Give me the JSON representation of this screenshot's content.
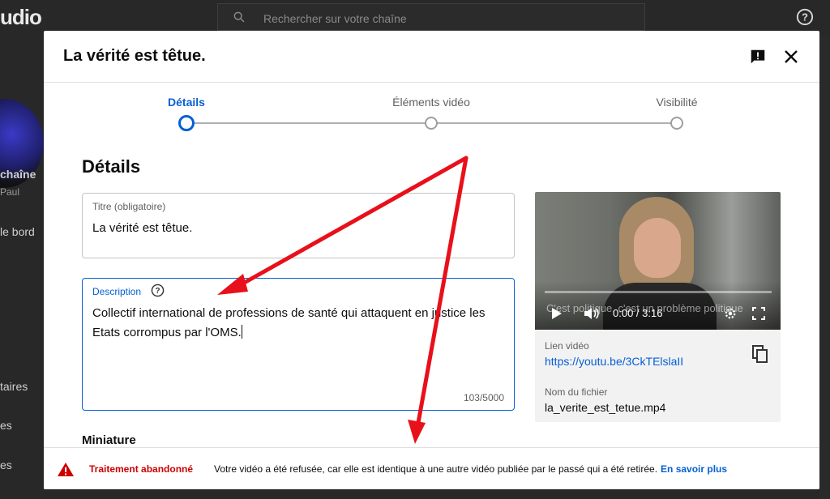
{
  "background": {
    "logo_fragment": "udio",
    "search_placeholder": "Rechercher sur votre chaîne",
    "sidebar_texts": [
      "chaîne",
      "Paul",
      "le bord",
      "taires",
      "es",
      "es"
    ]
  },
  "modal": {
    "title": "La vérité est têtue.",
    "stepper": {
      "steps": [
        {
          "label": "Détails",
          "state": "active"
        },
        {
          "label": "Éléments vidéo",
          "state": "pending"
        },
        {
          "label": "Visibilité",
          "state": "pending"
        }
      ]
    },
    "section_title": "Détails",
    "title_field": {
      "label": "Titre (obligatoire)",
      "value": "La vérité est têtue."
    },
    "description_field": {
      "label": "Description",
      "value": "Collectif international de professions de santé qui attaquent en justice les Etats corrompus par l'OMS.",
      "counter": "103/5000"
    },
    "thumbnail_heading": "Miniature",
    "video": {
      "caption_overlay": "C'est politique, c'est un problème politique",
      "time": "0:00 / 3:16",
      "link_label": "Lien vidéo",
      "link": "https://youtu.be/3CkTElslaII",
      "filename_label": "Nom du fichier",
      "filename": "la_verite_est_tetue.mp4"
    },
    "footer": {
      "status": "Traitement abandonné",
      "message": "Votre vidéo a été refusée, car elle est identique à une autre vidéo publiée par le passé qui a été retirée.",
      "link": "En savoir plus"
    }
  },
  "colors": {
    "accent": "#065fd4",
    "error": "#cc0000",
    "annotation": "#e8101a"
  },
  "icons": [
    "search-icon",
    "help-icon",
    "feedback-icon",
    "close-icon",
    "help-circle-icon",
    "play-icon",
    "volume-icon",
    "settings-icon",
    "fullscreen-icon",
    "copy-icon",
    "alert-triangle-icon"
  ]
}
